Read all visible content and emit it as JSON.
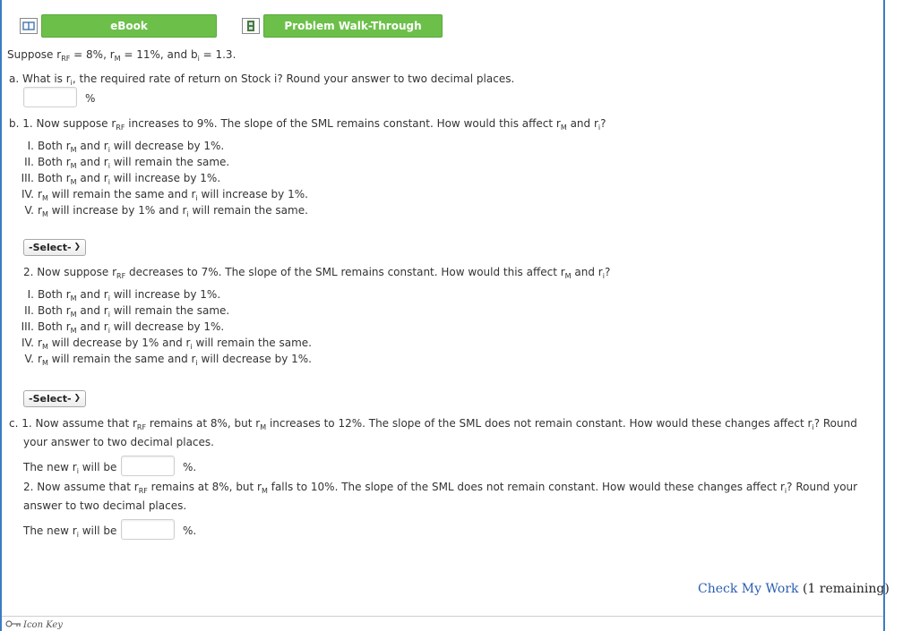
{
  "toolbar": {
    "ebook_label": "eBook",
    "walkthrough_label": "Problem Walk-Through"
  },
  "intro": {
    "prefix": "Suppose r",
    "rf_sub": "RF",
    "mid1": " = 8%, r",
    "m_sub": "M",
    "mid2": " = 11%, and b",
    "i_sub": "i",
    "end": " = 1.3."
  },
  "part_a": {
    "q_prefix": "a. What is r",
    "q_sub": "i",
    "q_rest": ", the required rate of return on Stock i? Round your answer to two decimal places.",
    "unit": "%"
  },
  "part_b1": {
    "q_a": "b. 1. Now suppose r",
    "q_b": " increases to 9%. The slope of the SML remains constant. How would this affect r",
    "q_c": " and r",
    "q_d": "?",
    "options": [
      {
        "num": "I.",
        "a": "Both r",
        "b": " and r",
        "c": " will decrease by 1%."
      },
      {
        "num": "II.",
        "a": "Both r",
        "b": " and r",
        "c": " will remain the same."
      },
      {
        "num": "III.",
        "a": "Both r",
        "b": " and r",
        "c": " will increase by 1%."
      },
      {
        "num": "IV.",
        "a": "r",
        "b": " will remain the same and r",
        "c": " will increase by 1%."
      },
      {
        "num": "V.",
        "a": "r",
        "b": " will increase by 1% and r",
        "c": " will remain the same."
      }
    ],
    "select": "-Select-"
  },
  "part_b2": {
    "q_a": "2. Now suppose r",
    "q_b": " decreases to 7%. The slope of the SML remains constant. How would this affect r",
    "q_c": " and r",
    "q_d": "?",
    "options": [
      {
        "num": "I.",
        "a": "Both r",
        "b": " and r",
        "c": " will increase by 1%."
      },
      {
        "num": "II.",
        "a": "Both r",
        "b": " and r",
        "c": " will remain the same."
      },
      {
        "num": "III.",
        "a": "Both r",
        "b": " and r",
        "c": " will decrease by 1%."
      },
      {
        "num": "IV.",
        "a": "r",
        "b": " will decrease by 1% and r",
        "c": " will remain the same."
      },
      {
        "num": "V.",
        "a": "r",
        "b": " will remain the same and r",
        "c": " will decrease by 1%."
      }
    ],
    "select": "-Select-"
  },
  "part_c1": {
    "q_a": "c. 1. Now assume that r",
    "q_b": " remains at 8%, but r",
    "q_c": " increases to 12%. The slope of the SML does not remain constant. How would these changes affect r",
    "q_d": "? Round",
    "line2": "your answer to two decimal places.",
    "answer_prefix": "The new r",
    "answer_mid": " will be",
    "answer_unit": "%."
  },
  "part_c2": {
    "q_a": "2. Now assume that r",
    "q_b": " remains at 8%, but r",
    "q_c": " falls to 10%. The slope of the SML does not remain constant. How would these changes affect r",
    "q_d": "? Round your",
    "line2": "answer to two decimal places.",
    "answer_prefix": "The new r",
    "answer_mid": " will be",
    "answer_unit": "%."
  },
  "footer": {
    "check_link": "Check My Work",
    "remaining": " (1 remaining)",
    "icon_key": "Icon Key"
  },
  "subs": {
    "rf": "RF",
    "m": "M",
    "i": "i"
  }
}
